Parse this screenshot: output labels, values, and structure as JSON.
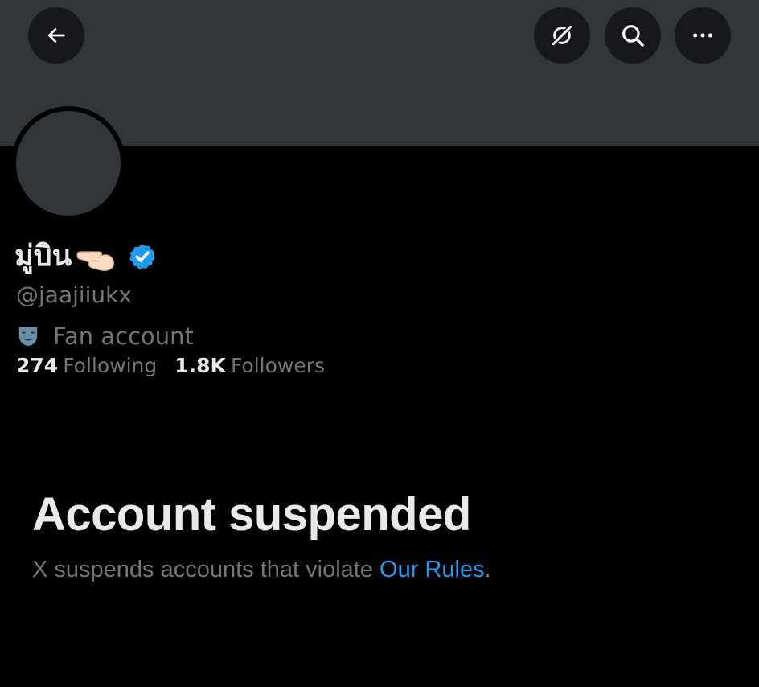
{
  "profile": {
    "display_name": "มู่บิน",
    "name_emoji": "👈🏻",
    "handle": "@jaajiiukx",
    "category_icon": "theater-mask-icon",
    "category": "Fan account",
    "following_count": "274",
    "following_label": "Following",
    "followers_count": "1.8K",
    "followers_label": "Followers"
  },
  "header": {
    "back_icon": "arrow-left-icon",
    "grok_icon": "grok-icon",
    "search_icon": "search-icon",
    "more_icon": "more-icon"
  },
  "suspension": {
    "title": "Account suspended",
    "message": "X suspends accounts that violate ",
    "link_text": "Our Rules",
    "message_end": "."
  },
  "colors": {
    "background": "#000000",
    "banner": "#333639",
    "primary_text": "#e7e9ea",
    "secondary_text": "#71767b",
    "accent": "#1d9bf0"
  }
}
